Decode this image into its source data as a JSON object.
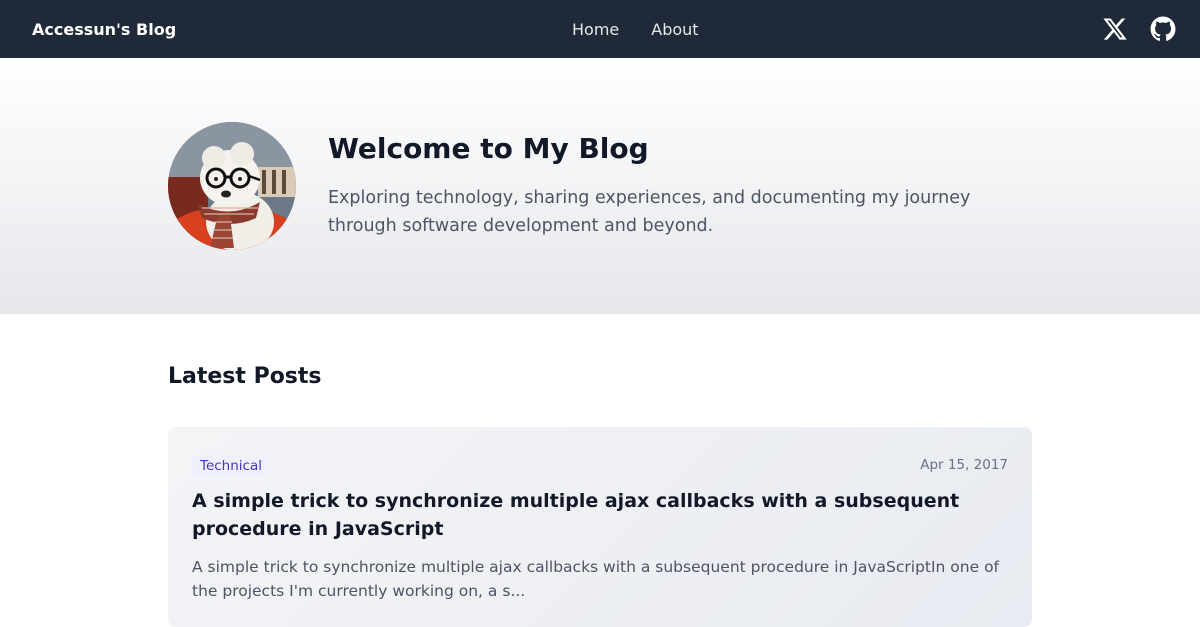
{
  "nav": {
    "brand": "Accessun's Blog",
    "links": [
      {
        "label": "Home"
      },
      {
        "label": "About"
      }
    ],
    "social": [
      {
        "icon": "x-twitter-icon"
      },
      {
        "icon": "github-icon"
      }
    ]
  },
  "hero": {
    "title": "Welcome to My Blog",
    "subtitle": "Exploring technology, sharing experiences, and documenting my journey through software development and beyond."
  },
  "latest": {
    "heading": "Latest Posts",
    "posts": [
      {
        "category": "Technical",
        "date": "Apr 15, 2017",
        "title": "A simple trick to synchronize multiple ajax callbacks with a subsequent procedure in JavaScript",
        "excerpt": "A simple trick to synchronize multiple ajax callbacks with a subsequent procedure in JavaScriptIn one of the projects I'm currently working on, a s..."
      }
    ]
  },
  "colors": {
    "navbar_bg": "#1f2937",
    "badge_text": "#4338ca",
    "card_bg": "#f3f4f6"
  }
}
